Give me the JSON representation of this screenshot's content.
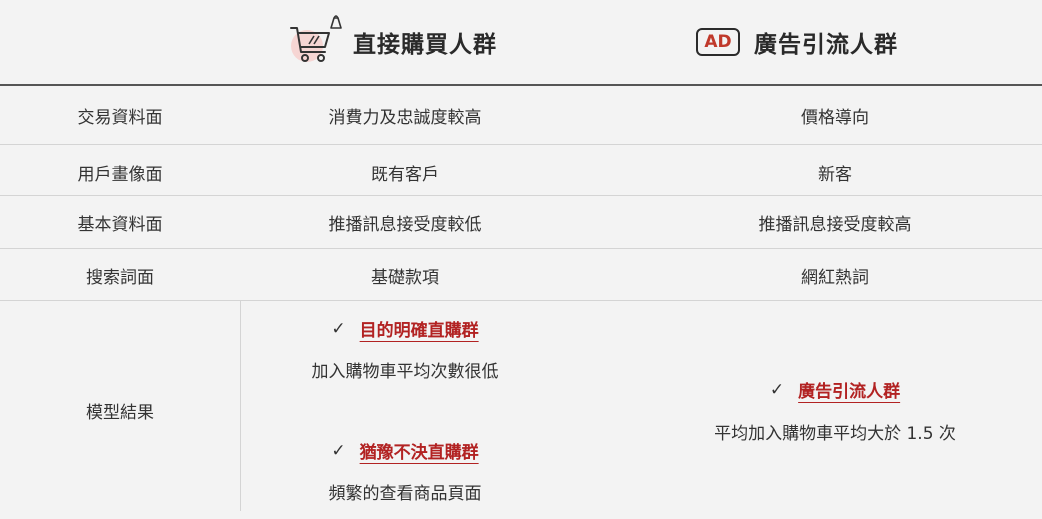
{
  "header": {
    "col2_title": "直接購買人群",
    "col3_title": "廣告引流人群",
    "ad_icon_text": "AD",
    "col2_icon": "shopping-cart-icon",
    "col3_icon": "ad-badge-icon"
  },
  "rows": [
    {
      "label": "交易資料面",
      "col2": "消費力及忠誠度較高",
      "col3": "價格導向"
    },
    {
      "label": "用戶畫像面",
      "col2": "既有客戶",
      "col3": "新客"
    },
    {
      "label": "基本資料面",
      "col2": "推播訊息接受度較低",
      "col3": "推播訊息接受度較高"
    },
    {
      "label": "搜索詞面",
      "col2": "基礎款項",
      "col3": "網紅熱詞"
    }
  ],
  "model": {
    "label": "模型結果",
    "check_mark": "✓",
    "col2_items": [
      {
        "title": "目的明確直購群",
        "desc": "加入購物車平均次數很低"
      },
      {
        "title": "猶豫不決直購群",
        "desc": "頻繁的查看商品頁面"
      }
    ],
    "col3_items": [
      {
        "title": "廣告引流人群",
        "desc": "平均加入購物車平均大於 1.5 次"
      }
    ]
  },
  "colors": {
    "accent_red": "#b22222",
    "background": "#f3f3f3",
    "text": "#333333"
  }
}
